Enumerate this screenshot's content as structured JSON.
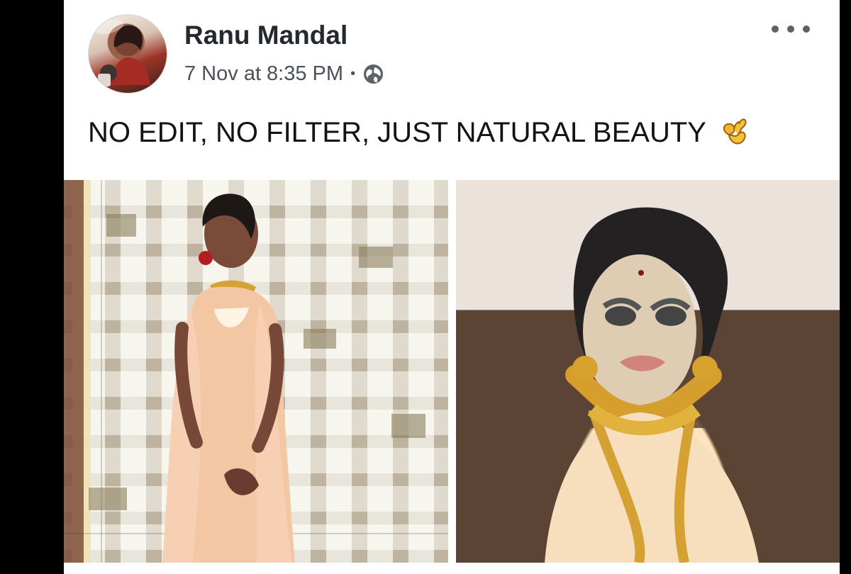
{
  "post": {
    "author": "Ranu Mandal",
    "date": "7 Nov at 8:35 PM",
    "meta_separator": "•",
    "caption": "NO EDIT, NO FILTER, JUST NATURAL BEAUTY",
    "reaction_icon": "ok-hand-icon",
    "privacy_icon": "globe-icon",
    "menu_icon": "more-options-icon"
  },
  "colors": {
    "card": "#ffffff",
    "author": "#24282f",
    "meta": "#4b5059",
    "caption": "#111317",
    "background": "#000000"
  }
}
